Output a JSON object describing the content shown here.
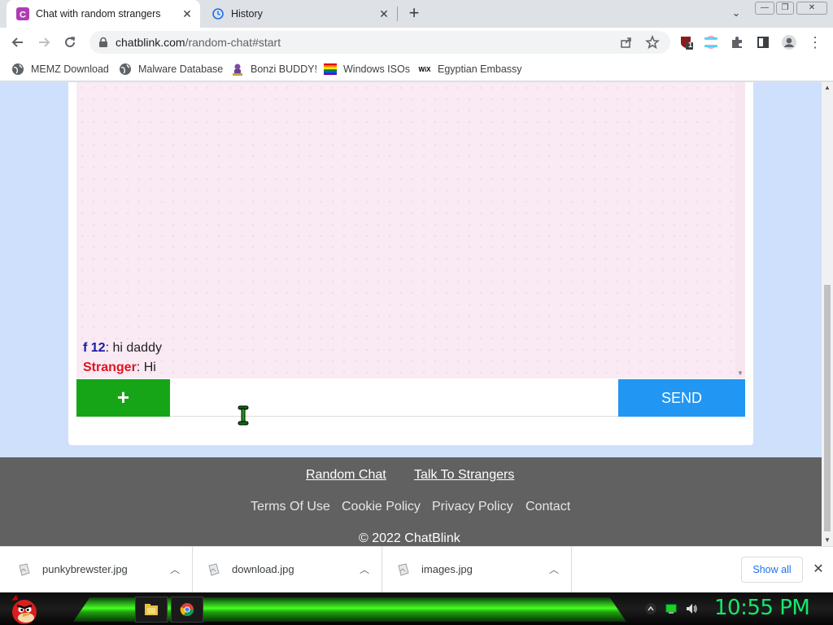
{
  "browser": {
    "tabs": [
      {
        "title": "Chat with random strangers",
        "favicon": "chatblink-c-icon",
        "active": true
      },
      {
        "title": "History",
        "favicon": "history-icon",
        "active": false
      }
    ],
    "url_host": "chatblink.com",
    "url_path": "/random-chat#start",
    "extension_badge": "1",
    "bookmarks": [
      {
        "label": "MEMZ Download",
        "icon": "globe-icon"
      },
      {
        "label": "Malware Database",
        "icon": "globe-icon"
      },
      {
        "label": "Bonzi BUDDY!",
        "icon": "bonzi-icon"
      },
      {
        "label": "Windows ISOs",
        "icon": "rainbow-flag-icon"
      },
      {
        "label": "Egyptian Embassy",
        "icon": "wix-icon"
      }
    ]
  },
  "chat": {
    "messages": [
      {
        "sender": "f 12",
        "text": ": hi daddy",
        "sender_color": "#1a1aa6"
      },
      {
        "sender": "Stranger",
        "text": ": Hi",
        "sender_color": "#e0141e"
      }
    ],
    "plus_label": "+",
    "input_value": "",
    "send_label": "SEND"
  },
  "footer": {
    "primary_links": [
      "Random Chat",
      "Talk To Strangers"
    ],
    "secondary_links": [
      "Terms Of Use",
      "Cookie Policy",
      "Privacy Policy",
      "Contact"
    ],
    "copyright": "© 2022 ChatBlink"
  },
  "downloads": {
    "items": [
      "punkybrewster.jpg",
      "download.jpg",
      "images.jpg"
    ],
    "show_all_label": "Show all"
  },
  "taskbar": {
    "clock": "10:55 PM",
    "apps": [
      "file-explorer-icon",
      "chrome-icon"
    ]
  },
  "colors": {
    "send_button": "#2196f3",
    "plus_button": "#16a516",
    "page_background": "#cfe0fd",
    "footer_background": "#616161",
    "clock": "#17e86b"
  }
}
